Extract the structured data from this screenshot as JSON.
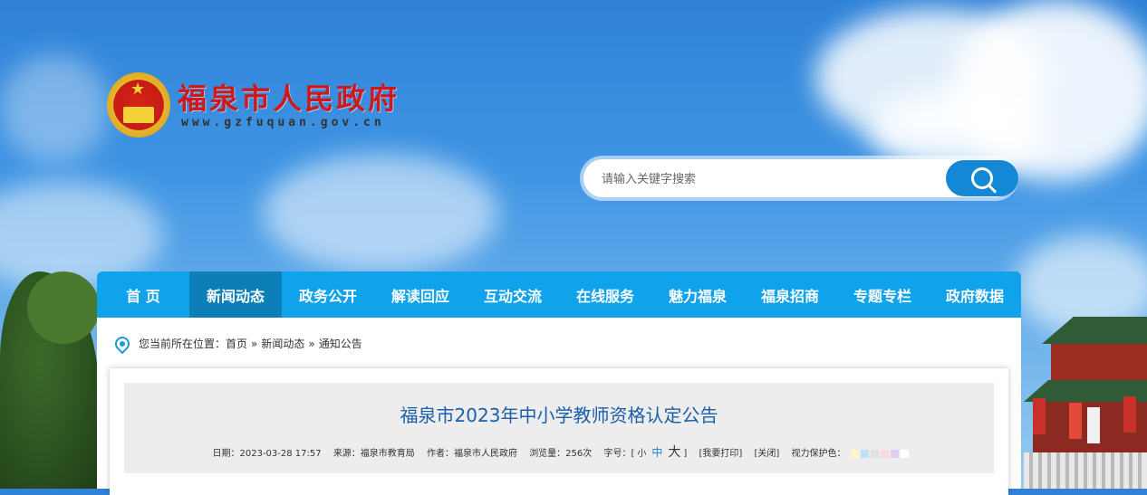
{
  "site": {
    "title": "福泉市人民政府",
    "url": "www.gzfuquan.gov.cn"
  },
  "search": {
    "placeholder": "请输入关键字搜索",
    "button_icon": "search-icon"
  },
  "nav": {
    "items": [
      {
        "label": "首 页"
      },
      {
        "label": "新闻动态"
      },
      {
        "label": "政务公开"
      },
      {
        "label": "解读回应"
      },
      {
        "label": "互动交流"
      },
      {
        "label": "在线服务"
      },
      {
        "label": "魅力福泉"
      },
      {
        "label": "福泉招商"
      },
      {
        "label": "专题专栏"
      },
      {
        "label": "政府数据"
      }
    ],
    "active_index": 1,
    "color": "#10a3ec",
    "active_color": "#0c7fb8"
  },
  "breadcrumb": {
    "prefix": "您当前所在位置：",
    "items": [
      "首页",
      "新闻动态",
      "通知公告"
    ],
    "separator": "»"
  },
  "article": {
    "title": "福泉市2023年中小学教师资格认定公告",
    "date": "日期：2023-03-28 17:57",
    "source": "来源：福泉市教育局",
    "author": "作者：福泉市人民政府",
    "views": "浏览量：256次",
    "font_size_label": "字号：[",
    "font_small": "小",
    "font_medium": "中",
    "font_large": "大",
    "font_close": "]",
    "print": "[我要打印]",
    "close": "[关闭]",
    "eye_care": "视力保护色：",
    "eye_care_colors": [
      "#fdf6c8",
      "#bfe3f2",
      "#e0e0e0",
      "#f8d7e0",
      "#e2cdf2",
      "#ffffff"
    ]
  }
}
